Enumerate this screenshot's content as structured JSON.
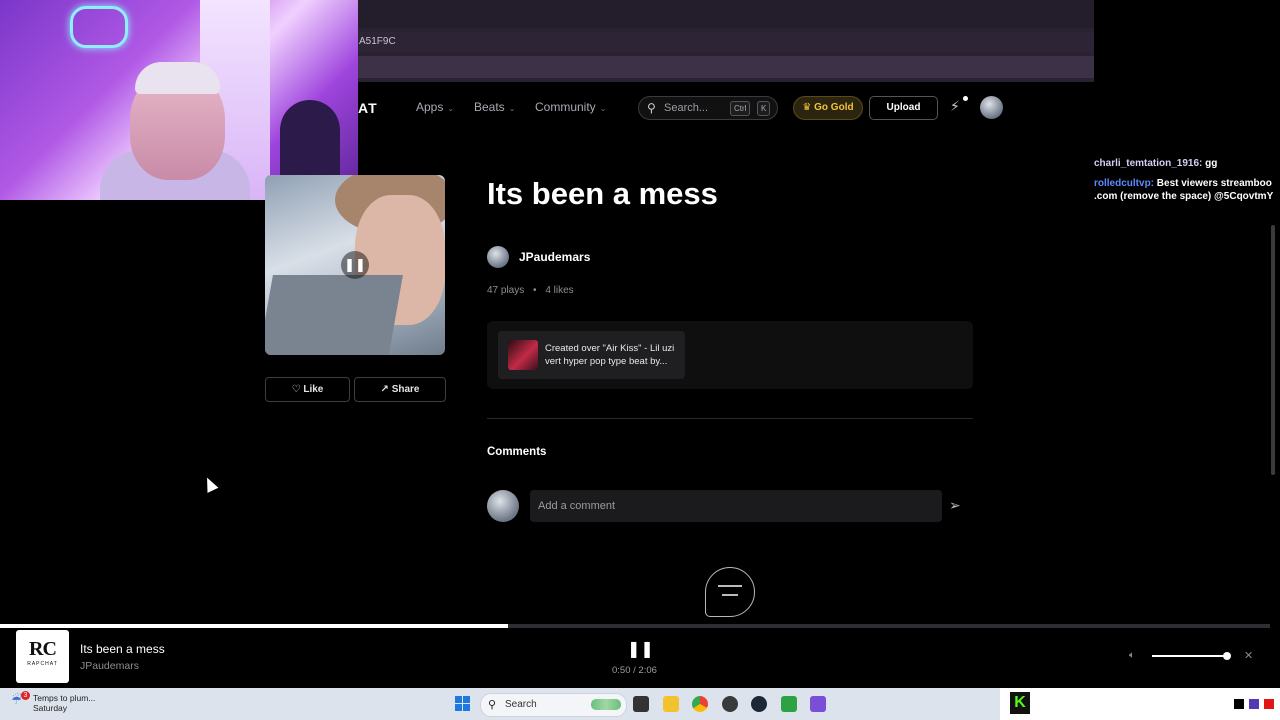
{
  "browser": {
    "address_fragment": "A51F9C"
  },
  "nav": {
    "brand_fragment": "AT",
    "links": [
      {
        "label": "Apps"
      },
      {
        "label": "Beats"
      },
      {
        "label": "Community"
      }
    ],
    "search_placeholder": "Search...",
    "search_kbd": [
      "Ctrl",
      "K"
    ],
    "go_gold_label": "Go Gold",
    "go_gold_icon": "crown-icon",
    "upload_label": "Upload"
  },
  "track": {
    "title": "Its been a mess",
    "artist": "JPaudemars",
    "plays": "47 plays",
    "separator": "•",
    "likes": "4 likes",
    "like_label": "Like",
    "share_label": "Share",
    "beat_credit": "Created over \"Air Kiss\" - Lil uzi vert hyper pop type beat by..."
  },
  "comments": {
    "heading": "Comments",
    "placeholder": "Add a comment"
  },
  "chat": [
    {
      "user": "charli_temtation_1916:",
      "text": "gg"
    },
    {
      "user": "rolledcultvp:",
      "text": "Best viewers streamboo .com (remove the space) @5CqovtmY"
    }
  ],
  "player": {
    "logo_text": "RC",
    "logo_sub": "RAPCHAT",
    "title": "Its been a mess",
    "artist": "JPaudemars",
    "time": "0:50 / 2:06",
    "progress": 0.4,
    "volume": 1.0,
    "accent": "#ffffff"
  },
  "taskbar": {
    "weather_badge": "3",
    "weather_line1": "Temps to plum...",
    "weather_line2": "Saturday",
    "search_label": "Search"
  },
  "colors": {
    "gold": "#f5c432",
    "background": "#000000",
    "kick_green": "#53fc18"
  }
}
